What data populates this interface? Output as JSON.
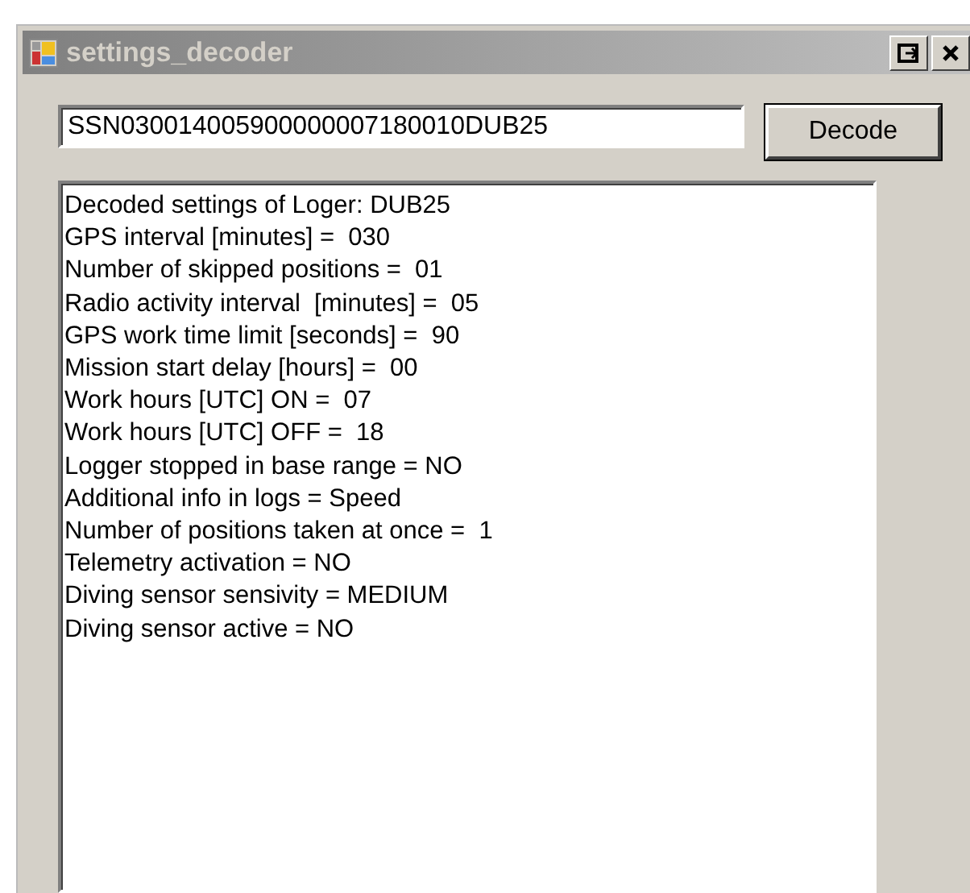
{
  "window": {
    "title": "settings_decoder"
  },
  "input": {
    "value": "SSN030014005900000007180010DUB25"
  },
  "decode_button": "Decode",
  "output_lines": [
    "Decoded settings of Loger: DUB25",
    "GPS interval [minutes] =  030",
    "Number of skipped positions =  01",
    "Radio activity interval  [minutes] =  05",
    "GPS work time limit [seconds] =  90",
    "Mission start delay [hours] =  00",
    "Work hours [UTC] ON =  07",
    "Work hours [UTC] OFF =  18",
    "Logger stopped in base range = NO",
    "Additional info in logs = Speed",
    "Number of positions taken at once =  1",
    "Telemetry activation = NO",
    "Diving sensor sensivity = MEDIUM",
    "Diving sensor active = NO"
  ]
}
